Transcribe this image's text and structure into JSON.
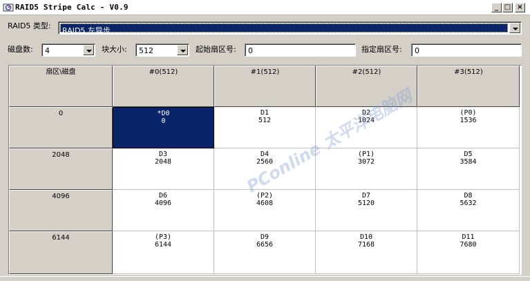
{
  "window": {
    "title": "RAID5 Stripe Calc - V0.9",
    "min_symbol": "_",
    "max_symbol": "□",
    "close_symbol": "×"
  },
  "type_row": {
    "label": "RAID5 类型:",
    "value": "RAID5 左异步"
  },
  "params": {
    "disk_count_label": "磁盘数:",
    "disk_count_value": "4",
    "block_size_label": "块大小:",
    "block_size_value": "512",
    "start_sector_label": "起始扇区号:",
    "start_sector_value": "0",
    "target_sector_label": "指定扇区号:",
    "target_sector_value": "0"
  },
  "grid": {
    "corner_header": "扇区\\磁盘",
    "disk_headers": [
      "#0(512)",
      "#1(512)",
      "#2(512)",
      "#3(512)"
    ],
    "rows": [
      {
        "sector": "0",
        "cells": [
          {
            "block": "*D0",
            "offset": "0",
            "selected": true
          },
          {
            "block": "D1",
            "offset": "512"
          },
          {
            "block": "D2",
            "offset": "1024"
          },
          {
            "block": "(P0)",
            "offset": "1536"
          }
        ]
      },
      {
        "sector": "2048",
        "cells": [
          {
            "block": "D3",
            "offset": "2048"
          },
          {
            "block": "D4",
            "offset": "2560"
          },
          {
            "block": "(P1)",
            "offset": "3072"
          },
          {
            "block": "D5",
            "offset": "3584"
          }
        ]
      },
      {
        "sector": "4096",
        "cells": [
          {
            "block": "D6",
            "offset": "4096"
          },
          {
            "block": "(P2)",
            "offset": "4608"
          },
          {
            "block": "D7",
            "offset": "5120"
          },
          {
            "block": "D8",
            "offset": "5632"
          }
        ]
      },
      {
        "sector": "6144",
        "cells": [
          {
            "block": "(P3)",
            "offset": "6144"
          },
          {
            "block": "D9",
            "offset": "6656"
          },
          {
            "block": "D10",
            "offset": "7168"
          },
          {
            "block": "D11",
            "offset": "7680"
          }
        ]
      }
    ]
  },
  "watermark": "PConline 太平洋电脑网",
  "icons": {
    "app": "raid-app-icon"
  },
  "colors": {
    "selection": "#0a246a",
    "face": "#d4d0c8"
  }
}
